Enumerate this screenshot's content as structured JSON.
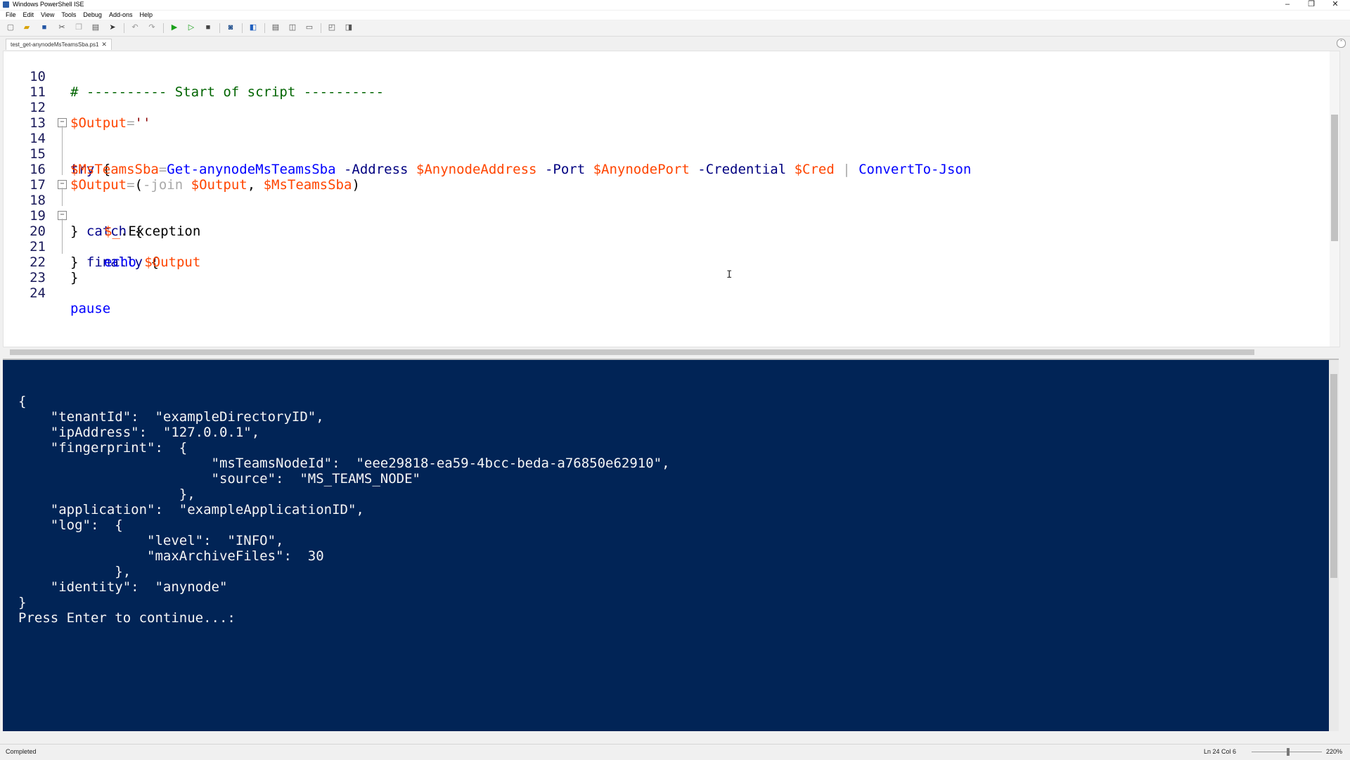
{
  "window": {
    "title": "Windows PowerShell ISE",
    "minimize": "–",
    "restore": "❐",
    "close": "✕"
  },
  "menu": [
    "File",
    "Edit",
    "View",
    "Tools",
    "Debug",
    "Add-ons",
    "Help"
  ],
  "tab": {
    "label": "test_get-anynodeMsTeamsSba.ps1",
    "close": "✕"
  },
  "editor": {
    "line_numbers": [
      "10",
      "11",
      "12",
      "13",
      "14",
      "15",
      "16",
      "17",
      "18",
      "19",
      "20",
      "21",
      "22",
      "23",
      "24"
    ],
    "lines": {
      "l10_comment": "# ---------- Start of script ----------",
      "l12_var": "$Output",
      "l12_op": "=",
      "l12_str": "''",
      "l14_kw": "try",
      "l14_brace": " {",
      "l15_var1": "$MsTeamsSba",
      "l15_op1": "=",
      "l15_cmd1": "Get-anynodeMsTeamsSba",
      "l15_par1": " -Address ",
      "l15_var2": "$AnynodeAddress",
      "l15_par2": " -Port ",
      "l15_var3": "$AnynodePort",
      "l15_par3": " -Credential ",
      "l15_var4": "$Cred",
      "l15_op2": " | ",
      "l15_cmd2": "ConvertTo-Json",
      "l16_var1": "$Output",
      "l16_op1": "=",
      "l16_txt1": "(",
      "l16_op2": "-join",
      "l16_var2": " $Output",
      "l16_txt2": ", ",
      "l16_var3": "$MsTeamsSba",
      "l16_txt3": ")",
      "l18_brace": "} ",
      "l18_kw": "catch",
      "l18_brace2": " {",
      "l19_var": "$_",
      "l19_txt": ".Exception",
      "l20_brace": "} ",
      "l20_kw": "finally",
      "l20_brace2": " {",
      "l21_cmd": "echo",
      "l21_var": " $Output",
      "l22_brace": "}",
      "l24_cmd": "pause"
    },
    "fold_symbol": "−",
    "cursor_glyph": "I"
  },
  "console": {
    "lines": [
      "{",
      "    \"tenantId\":  \"exampleDirectoryID\",",
      "    \"ipAddress\":  \"127.0.0.1\",",
      "    \"fingerprint\":  {",
      "                        \"msTeamsNodeId\":  \"eee29818-ea59-4bcc-beda-a76850e62910\",",
      "                        \"source\":  \"MS_TEAMS_NODE\"",
      "                    },",
      "    \"application\":  \"exampleApplicationID\",",
      "    \"log\":  {",
      "                \"level\":  \"INFO\",",
      "                \"maxArchiveFiles\":  30",
      "            },",
      "    \"identity\":  \"anynode\"",
      "}",
      "Press Enter to continue...:"
    ]
  },
  "status": {
    "state": "Completed",
    "position": "Ln 24  Col 6",
    "zoom": "220%"
  },
  "colors": {
    "console_bg": "#012456",
    "keyword": "#00008b",
    "comment": "#006400",
    "variable": "#ff4500",
    "command": "#0000ff",
    "parameter": "#000080",
    "string": "#8b0000"
  }
}
